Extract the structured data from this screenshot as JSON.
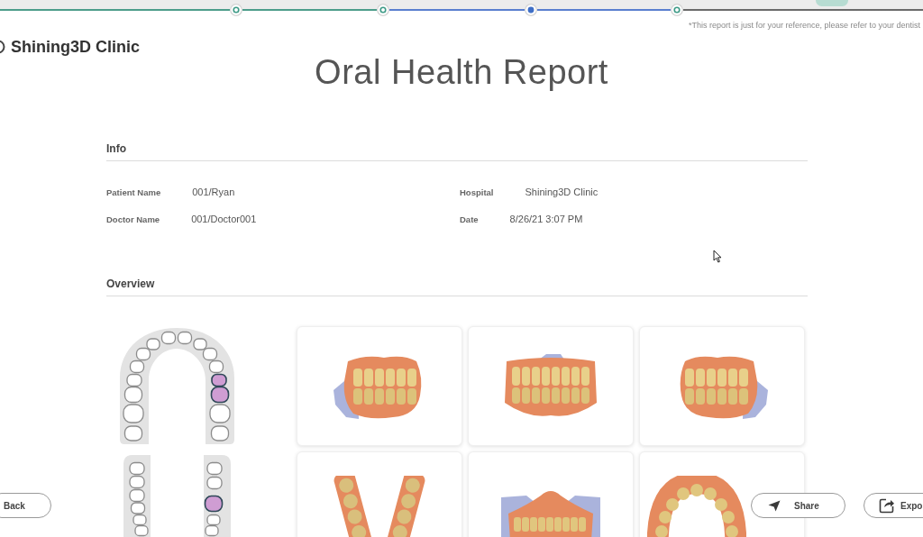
{
  "progress": {
    "steps": [
      {
        "selected": false
      },
      {
        "selected": false
      },
      {
        "selected": true
      },
      {
        "selected": false
      }
    ]
  },
  "notice": "*This report is just for your reference, please refer to your dentist",
  "clinic": {
    "name": "Shining3D Clinic"
  },
  "title": "Oral Health Report",
  "info": {
    "heading": "Info",
    "fields": [
      {
        "label": "Patient Name",
        "value": "001/Ryan"
      },
      {
        "label": "Hospital",
        "value": "Shining3D Clinic"
      },
      {
        "label": "Doctor Name",
        "value": "001/Doctor001"
      },
      {
        "label": "Date",
        "value": "8/26/21 3:07 PM"
      }
    ]
  },
  "overview": {
    "heading": "Overview",
    "tooth_chart": {
      "upper": [
        {
          "marked": false
        },
        {
          "marked": false
        },
        {
          "marked": false
        },
        {
          "marked": false
        },
        {
          "marked": false
        },
        {
          "marked": false
        },
        {
          "marked": false
        },
        {
          "marked": false
        },
        {
          "marked": false
        },
        {
          "marked": false
        },
        {
          "marked": false
        },
        {
          "marked": false
        },
        {
          "marked": true
        },
        {
          "marked": true
        },
        {
          "marked": false
        },
        {
          "marked": false
        }
      ],
      "lower": [
        {
          "marked": false
        },
        {
          "marked": false
        },
        {
          "marked": false
        },
        {
          "marked": false
        },
        {
          "marked": false
        },
        {
          "marked": false
        },
        {
          "marked": false
        },
        {
          "marked": false
        },
        {
          "marked": true
        },
        {
          "marked": false
        },
        {
          "marked": false
        }
      ]
    },
    "scans": [
      {
        "kind": "side-left"
      },
      {
        "kind": "front"
      },
      {
        "kind": "side-right"
      },
      {
        "kind": "halves"
      },
      {
        "kind": "lower-front"
      },
      {
        "kind": "arch"
      }
    ]
  },
  "buttons": [
    {
      "label": "Back",
      "kind": "back"
    },
    {
      "label": "Share",
      "kind": "share"
    },
    {
      "label": "Expo",
      "kind": "export"
    }
  ]
}
